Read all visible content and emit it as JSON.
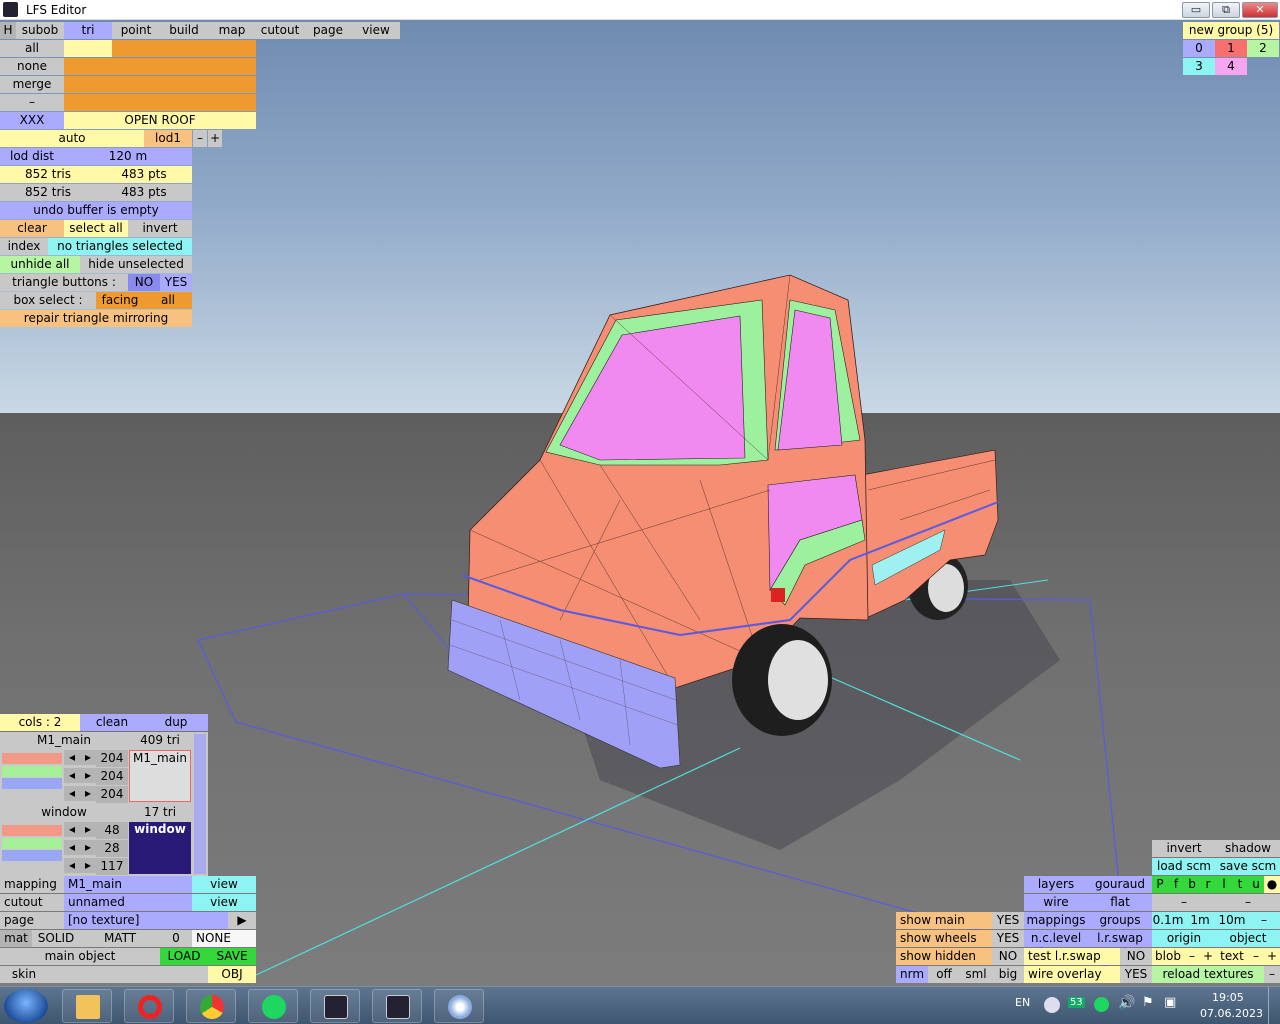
{
  "window": {
    "title": "LFS Editor",
    "minimize": "▭",
    "maximize": "⧉",
    "close": "✕"
  },
  "menu": {
    "h": "H",
    "items": [
      "subob",
      "tri",
      "point",
      "build",
      "map",
      "cutout",
      "page",
      "view"
    ]
  },
  "subob": {
    "all": "all",
    "none": "none",
    "merge": "merge",
    "dash": "–",
    "xxx": "XXX",
    "open_roof": "OPEN ROOF",
    "auto": "auto",
    "lod1": "lod1",
    "minus": "–",
    "plus": "+",
    "lod_dist_label": "lod dist",
    "lod_dist_value": "120 m",
    "tris1": "852 tris",
    "pts1": "483 pts",
    "tris2": "852 tris",
    "pts2": "483 pts",
    "undo": "undo buffer is empty",
    "clear": "clear",
    "select_all": "select all",
    "invert": "invert",
    "index": "index",
    "no_sel": "no triangles selected",
    "unhide_all": "unhide all",
    "hide_unselected": "hide unselected",
    "tri_buttons": "triangle buttons :",
    "no": "NO",
    "yes": "YES",
    "box_select": "box select :",
    "facing": "facing",
    "all2": "all",
    "repair": "repair triangle mirroring"
  },
  "groups": {
    "new_group": "new group (5)",
    "items": [
      "0",
      "1",
      "2",
      "3",
      "4"
    ]
  },
  "materials": {
    "cols": "cols : 2",
    "clean": "clean",
    "dup": "dup",
    "mat1_name": "M1_main",
    "mat1_tri": "409 tri",
    "mat1_rgb": [
      "204",
      "204",
      "204"
    ],
    "mat1_preview": "M1_main",
    "mat2_name": "window",
    "mat2_tri": "17 tri",
    "mat2_rgb": [
      "48",
      "28",
      "117"
    ],
    "mat2_preview": "window",
    "arrow_l": "◂",
    "arrow_r": "▸"
  },
  "bottom_left": {
    "mapping": "mapping",
    "mapping_val": "M1_main",
    "view1": "view",
    "cutout": "cutout",
    "cutout_val": "unnamed",
    "view2": "view",
    "page": "page",
    "page_val": "[no texture]",
    "page_arrow": "▶",
    "mat": "mat",
    "solid": "SOLID",
    "matt": "MATT",
    "zero": "0",
    "none": "NONE",
    "main_object": "main object",
    "load": "LOAD",
    "save": "SAVE",
    "skin": "skin",
    "obj": "OBJ"
  },
  "bottom_right": {
    "invert": "invert",
    "shadow": "shadow",
    "load_scm": "load scm",
    "save_scm": "save scm",
    "layers": "layers",
    "gouraud": "gouraud",
    "letters": [
      "P",
      "f",
      "b",
      "r",
      "l",
      "t",
      "u"
    ],
    "dot": "●",
    "wire": "wire",
    "flat": "flat",
    "dash1": "–",
    "dash2": "–",
    "show_main": "show main",
    "yes1": "YES",
    "mappings": "mappings",
    "groups": "groups",
    "m01": "0.1m",
    "m1": "1m",
    "m10": "10m",
    "dash3": "–",
    "show_wheels": "show wheels",
    "yes2": "YES",
    "nc_level": "n.c.level",
    "lr_swap": "l.r.swap",
    "origin": "origin",
    "object": "object",
    "show_hidden": "show hidden",
    "no1": "NO",
    "test_lr_swap": "test l.r.swap",
    "no2": "NO",
    "blob": "blob",
    "bminus": "–",
    "bplus": "+",
    "text": "text",
    "tminus": "–",
    "tplus": "+",
    "nrm": "nrm",
    "off": "off",
    "sml": "sml",
    "big": "big",
    "wire_overlay": "wire overlay",
    "yes3": "YES",
    "reload": "reload textures",
    "dash4": "–"
  },
  "taskbar": {
    "lang": "EN",
    "badge": "53",
    "time": "19:05",
    "date": "07.06.2023"
  },
  "colors": {
    "orange": "#ef9a2e",
    "purple": "#aaaaff",
    "yellow": "#fff9a8",
    "cyan": "#8ef3f3",
    "green": "#35d83a",
    "body": "#f58e72",
    "glass": "#f08af0",
    "trim": "#9df09d",
    "bumper": "#a0a0f6"
  }
}
